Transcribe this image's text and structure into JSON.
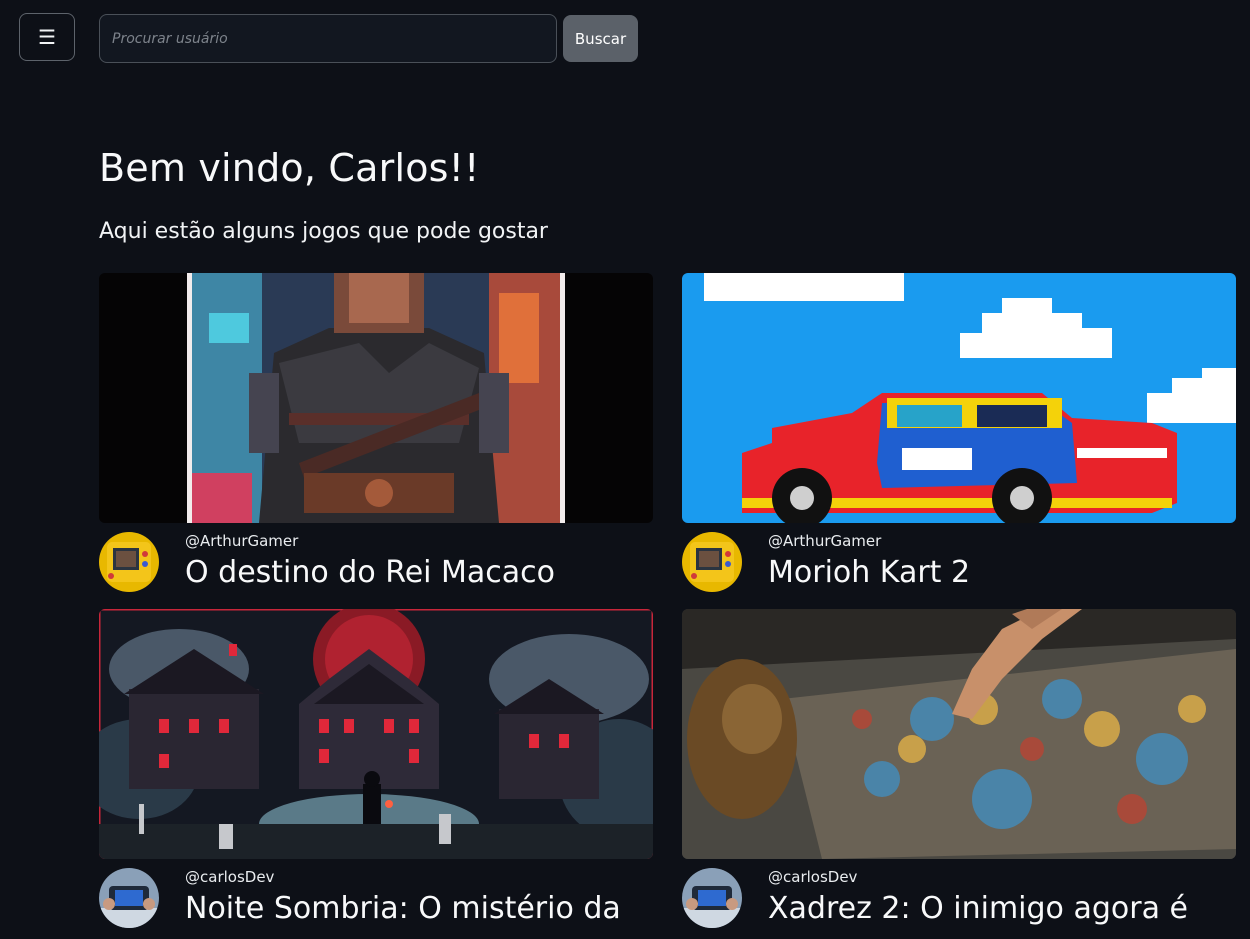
{
  "header": {
    "menu_icon": "hamburger-icon",
    "search_placeholder": "Procurar usuário",
    "search_value": "",
    "search_button_label": "Buscar"
  },
  "main": {
    "welcome": "Bem vindo, Carlos!!",
    "subtitle": "Aqui estão alguns jogos que pode gostar",
    "games": [
      {
        "author": "@ArthurGamer",
        "title": "O destino do Rei Macaco",
        "image": "pixel-art-warrior"
      },
      {
        "author": "@ArthurGamer",
        "title": "Morioh Kart 2",
        "image": "pixel-art-race-car"
      },
      {
        "author": "@carlosDev",
        "title": "Noite Sombria: O mistério da",
        "image": "pixel-art-haunted-mansion"
      },
      {
        "author": "@carlosDev",
        "title": "Xadrez 2: O inimigo agora é",
        "image": "jigsaw-puzzle-photo"
      }
    ]
  },
  "colors": {
    "background": "#0d1017",
    "button": "#5b6169",
    "text": "#f8f9fa"
  }
}
